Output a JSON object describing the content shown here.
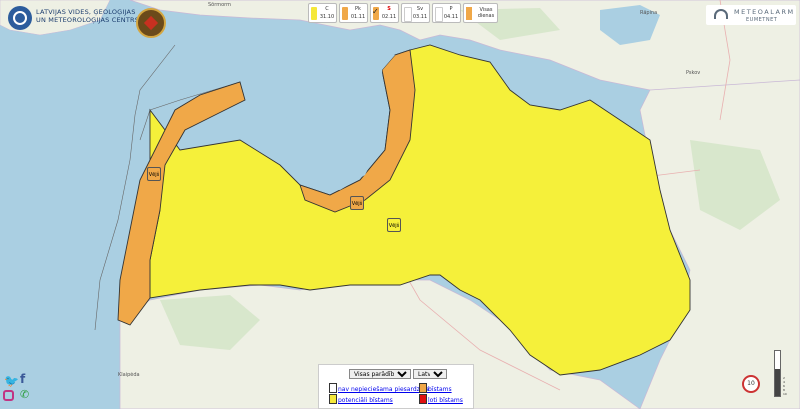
{
  "header": {
    "org_line1": "LATVIJAS VIDES, ĢEOLOĢIJAS",
    "org_line2": "UN METEOROLOĢIJAS CENTRS"
  },
  "days": [
    {
      "name": "C",
      "date": "31.10",
      "color": "#f5e83a",
      "selected": false
    },
    {
      "name": "Pk",
      "date": "01.11",
      "color": "#f0a848",
      "selected": false
    },
    {
      "name": "S",
      "date": "02.11",
      "color": "#f0a848",
      "selected": true
    },
    {
      "name": "Sv",
      "date": "03.11",
      "color": "#ffffff",
      "selected": false
    },
    {
      "name": "P",
      "date": "04.11",
      "color": "#ffffff",
      "selected": false
    }
  ],
  "all_days": {
    "line1": "Visas",
    "line2": "dienas",
    "color": "#f0a848"
  },
  "markers": [
    {
      "label": "Vējš",
      "color": "#f0a848"
    },
    {
      "label": "Vējš",
      "color": "#f0a848"
    },
    {
      "label": "Vējš",
      "color": "#f5f03a"
    }
  ],
  "controls": {
    "show_select": "Visas parādības",
    "lang_select": "Latviešu"
  },
  "legend": {
    "none": "nav nepieciešama piesardzība",
    "potential": "potenciāli bīstams",
    "dangerous": "bīstams",
    "very": "ļoti bīstams"
  },
  "legend_colors": {
    "none": "#ffffff",
    "potential": "#f5e83a",
    "dangerous": "#f0a848",
    "very": "#e01010"
  },
  "meteoalarm": {
    "line1": "METEOALARM",
    "line2": "EUMETNET"
  },
  "places": {
    "top_left": "Sõrmorm",
    "top_right": "Räpina",
    "right": "Pskov",
    "bottom_left": "Klaipėda"
  },
  "speed_badge": "10",
  "scale_labels": [
    "2",
    "4",
    "6",
    "8",
    "10"
  ]
}
